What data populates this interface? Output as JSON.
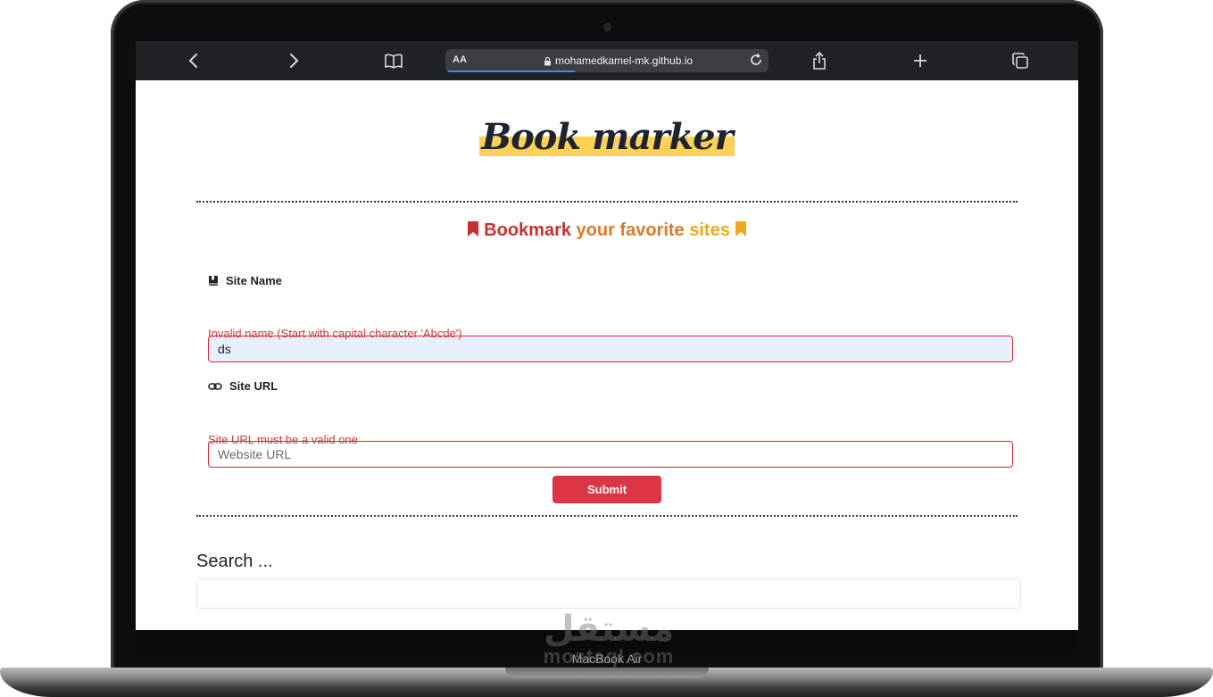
{
  "browser": {
    "url": "mohamedkamel-mk.github.io",
    "text_size_label": "AA"
  },
  "page": {
    "logo_text": "Book marker",
    "tagline": {
      "part1": "Bookmark ",
      "part2": "your favorite ",
      "part3": "sites"
    },
    "form": {
      "site_name_label": "Site Name",
      "site_name_value": "ds",
      "site_name_error": "Invalid name (Start with capital character 'Abcde')",
      "site_url_label": "Site URL",
      "site_url_placeholder": "Website URL",
      "site_url_error": "Site URL must be a valid one",
      "submit_label": "Submit"
    },
    "search": {
      "title": "Search ..."
    }
  },
  "device": {
    "brand_text": "MacBook Air",
    "watermark_arabic": "مستقل",
    "watermark_latin": "mostaql.com"
  },
  "colors": {
    "accent_red": "#dc3545",
    "logo_highlight": "#ffd257",
    "tagline_red": "#c7312d",
    "tagline_orange": "#dd7a2a",
    "tagline_yellow": "#f0a91c"
  }
}
